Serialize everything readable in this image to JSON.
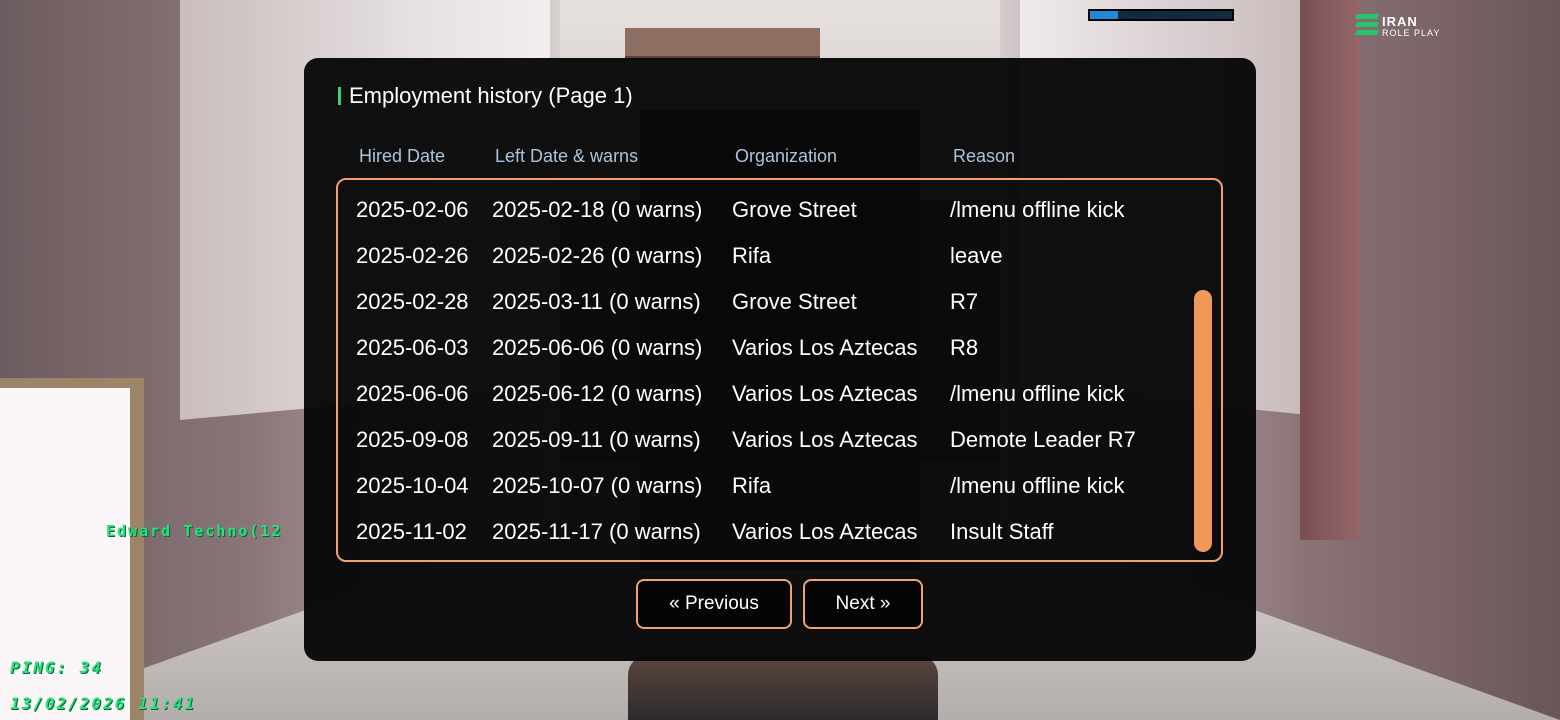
{
  "hud": {
    "health_fraction": 0.2,
    "health_color": "#1f8ad8",
    "logo_line1": "IRAN",
    "logo_line2": "ROLE PLAY",
    "player_tag": "Edward Techno(12",
    "ping": "PING: 34",
    "datetime": "13/02/2026 11:41"
  },
  "dialog": {
    "title": "Employment history (Page 1)",
    "accent_color": "#2ed47a",
    "border_color": "#f2a36b",
    "columns": [
      "Hired Date",
      "Left Date & warns",
      "Organization",
      "Reason"
    ],
    "rows": [
      {
        "hired": "2025-02-06",
        "left": "2025-02-18 (0 warns)",
        "org": "Grove Street",
        "reason": "/lmenu offline kick"
      },
      {
        "hired": "2025-02-26",
        "left": "2025-02-26 (0 warns)",
        "org": "Rifa",
        "reason": "leave"
      },
      {
        "hired": "2025-02-28",
        "left": "2025-03-11 (0 warns)",
        "org": "Grove Street",
        "reason": "R7"
      },
      {
        "hired": "2025-06-03",
        "left": "2025-06-06 (0 warns)",
        "org": "Varios Los Aztecas",
        "reason": "R8"
      },
      {
        "hired": "2025-06-06",
        "left": "2025-06-12 (0 warns)",
        "org": "Varios Los Aztecas",
        "reason": "/lmenu offline kick"
      },
      {
        "hired": "2025-09-08",
        "left": "2025-09-11 (0 warns)",
        "org": "Varios Los Aztecas",
        "reason": "Demote Leader R7"
      },
      {
        "hired": "2025-10-04",
        "left": "2025-10-07 (0 warns)",
        "org": "Rifa",
        "reason": "/lmenu offline kick"
      },
      {
        "hired": "2025-11-02",
        "left": "2025-11-17 (0 warns)",
        "org": "Varios Los Aztecas",
        "reason": "Insult Staff"
      }
    ],
    "previous_label": "« Previous",
    "next_label": "Next »"
  }
}
